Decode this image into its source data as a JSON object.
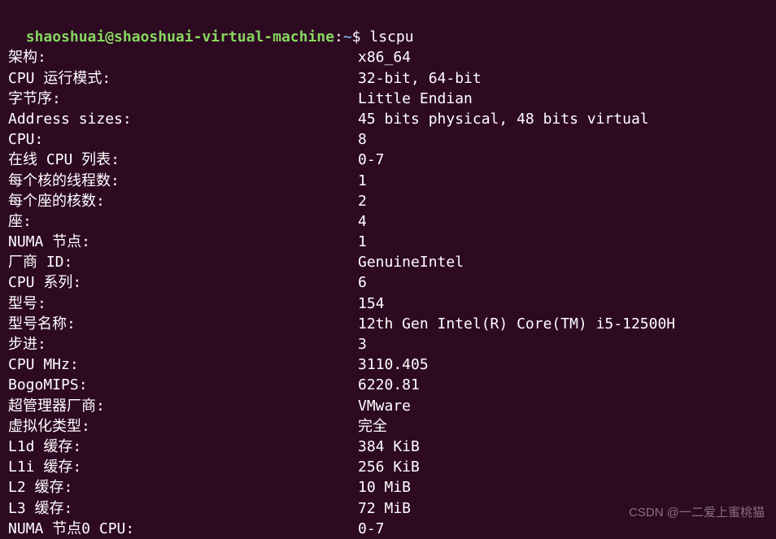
{
  "prompt": {
    "user_host": "shaoshuai@shaoshuai-virtual-machine",
    "colon": ":",
    "path": "~",
    "dollar": "$ ",
    "command": "lscpu"
  },
  "output": [
    {
      "label": "架构:",
      "value": "x86_64"
    },
    {
      "label": "CPU 运行模式:",
      "value": "32-bit, 64-bit"
    },
    {
      "label": "字节序:",
      "value": "Little Endian"
    },
    {
      "label": "Address sizes:",
      "value": "45 bits physical, 48 bits virtual"
    },
    {
      "label": "CPU:",
      "value": "8"
    },
    {
      "label": "在线 CPU 列表:",
      "value": "0-7"
    },
    {
      "label": "每个核的线程数:",
      "value": "1"
    },
    {
      "label": "每个座的核数:",
      "value": "2"
    },
    {
      "label": "座:",
      "value": "4"
    },
    {
      "label": "NUMA 节点:",
      "value": "1"
    },
    {
      "label": "厂商 ID:",
      "value": "GenuineIntel"
    },
    {
      "label": "CPU 系列:",
      "value": "6"
    },
    {
      "label": "型号:",
      "value": "154"
    },
    {
      "label": "型号名称:",
      "value": "12th Gen Intel(R) Core(TM) i5-12500H"
    },
    {
      "label": "步进:",
      "value": "3"
    },
    {
      "label": "CPU MHz:",
      "value": "3110.405"
    },
    {
      "label": "BogoMIPS:",
      "value": "6220.81"
    },
    {
      "label": "超管理器厂商:",
      "value": "VMware"
    },
    {
      "label": "虚拟化类型:",
      "value": "完全"
    },
    {
      "label": "L1d 缓存:",
      "value": "384 KiB"
    },
    {
      "label": "L1i 缓存:",
      "value": "256 KiB"
    },
    {
      "label": "L2 缓存:",
      "value": "10 MiB"
    },
    {
      "label": "L3 缓存:",
      "value": "72 MiB"
    },
    {
      "label": "NUMA 节点0 CPU:",
      "value": "0-7"
    }
  ],
  "watermark": "CSDN @一二爱上蜜桃猫"
}
